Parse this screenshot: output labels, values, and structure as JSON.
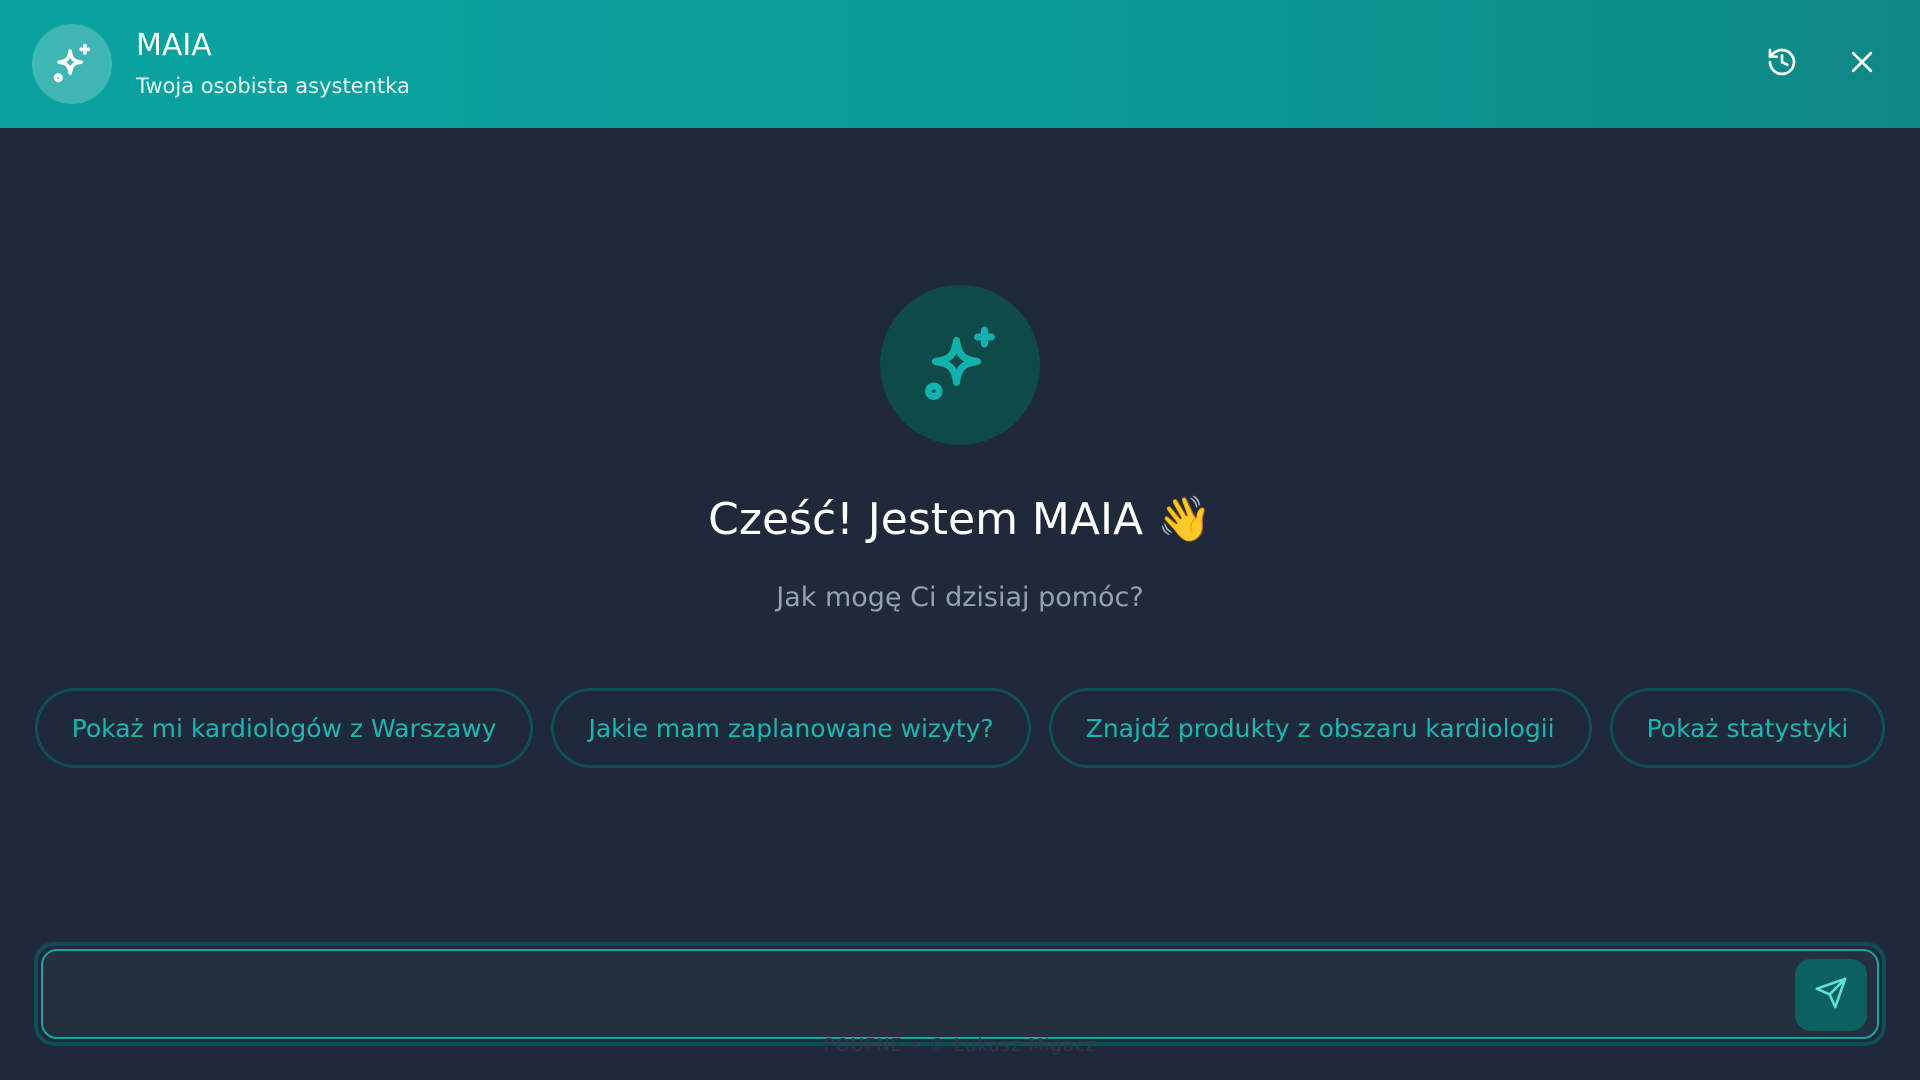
{
  "header": {
    "title": "MAIA",
    "subtitle": "Twoja osobista asystentka",
    "logo_icon": "sparkles-icon",
    "history_icon": "history-icon",
    "close_icon": "close-icon"
  },
  "hero": {
    "icon": "sparkles-icon",
    "greeting": "Cześć! Jestem MAIA",
    "greeting_emoji": "👋",
    "subtitle": "Jak mogę Ci dzisiaj pomóc?"
  },
  "suggestions": [
    {
      "label": "Pokaż mi kardiologów z Warszawy"
    },
    {
      "label": "Jakie mam zaplanowane wizyty?"
    },
    {
      "label": "Znajdź produkty z obszaru kardiologii"
    },
    {
      "label": "Pokaż statystyki"
    }
  ],
  "composer": {
    "value": "",
    "placeholder": "",
    "send_icon": "send-icon"
  },
  "footer": {
    "text": "POUFNE • © Łukasz Migacz"
  },
  "colors": {
    "accent": "#0aa3a0",
    "background": "#1f293a",
    "chip_text": "#19b6b2"
  }
}
